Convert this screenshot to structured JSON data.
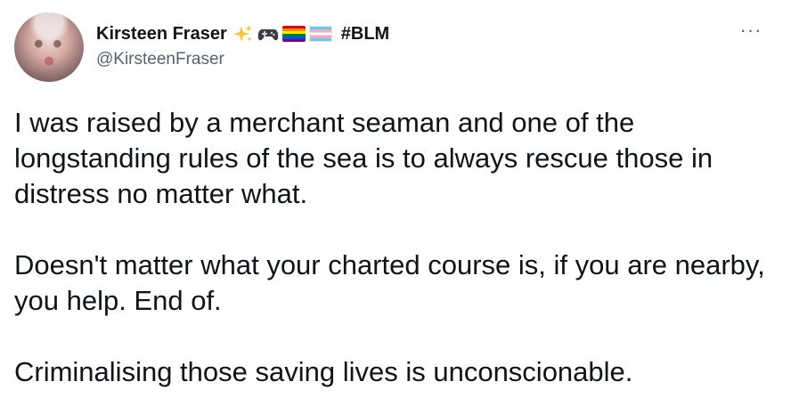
{
  "tweet": {
    "author": {
      "name": "Kirsteen Fraser",
      "name_suffix_emojis": [
        "sparkles",
        "video-game-controller",
        "rainbow-flag",
        "transgender-flag"
      ],
      "hashtag": "#BLM",
      "handle": "@KirsteenFraser"
    },
    "more_label": "···",
    "paragraphs": [
      "I was raised by a merchant seaman and one of the longstanding rules of the sea is to always rescue those in distress no matter what.",
      "Doesn't matter what your charted course is, if you are nearby, you help. End of.",
      "Criminalising those saving lives is unconscionable."
    ]
  },
  "colors": {
    "text_primary": "#0f1419",
    "text_secondary": "#536471",
    "background": "#ffffff",
    "sparkle": "#f5c542"
  }
}
